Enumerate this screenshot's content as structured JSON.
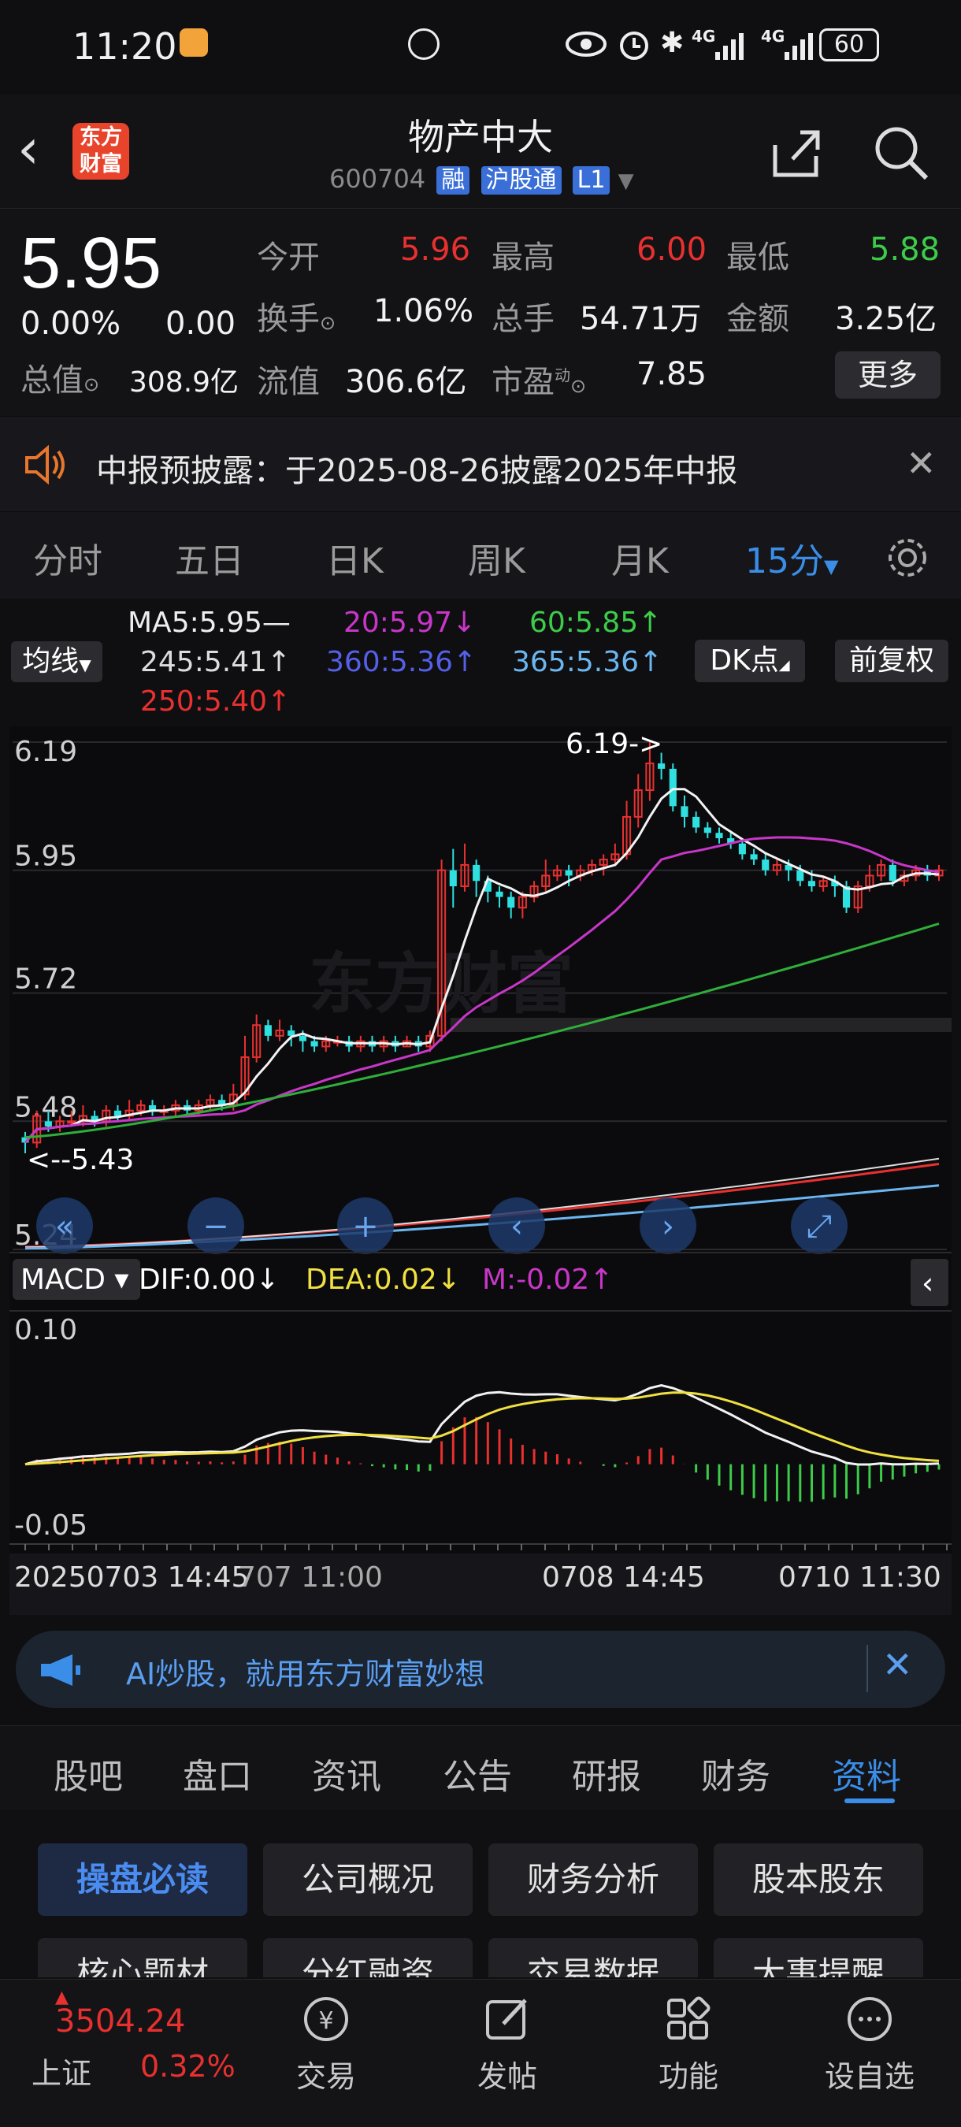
{
  "status": {
    "time": "11:20",
    "battery": "60",
    "net1": "4G",
    "net2": "4G"
  },
  "header": {
    "stock_name": "物产中大",
    "code": "600704",
    "badge1": "融",
    "badge2": "沪股通",
    "badge3": "L1",
    "logo": "东方财富"
  },
  "quote": {
    "price": "5.95",
    "change_pct": "0.00%",
    "change": "0.00",
    "open_label": "今开",
    "open": "5.96",
    "high_label": "最高",
    "high": "6.00",
    "low_label": "最低",
    "low": "5.88",
    "turnover_label": "换手",
    "turnover": "1.06%",
    "volume_label": "总手",
    "volume": "54.71万",
    "amount_label": "金额",
    "amount": "3.25亿",
    "mcap_label": "总值",
    "mcap": "308.9亿",
    "float_label": "流值",
    "float": "306.6亿",
    "pe_label": "市盈",
    "pe_sup": "动",
    "pe": "7.85",
    "more": "更多"
  },
  "notice": {
    "text": "中报预披露：于2025-08-26披露2025年中报"
  },
  "ktabs": [
    "分时",
    "五日",
    "日K",
    "周K",
    "月K",
    "15分"
  ],
  "ma": {
    "selector": "均线",
    "ma5": "MA5:5.95—",
    "ma20": "20:5.97↓",
    "ma60": "60:5.85↑",
    "ma245": "245:5.41↑",
    "ma360": "360:5.36↑",
    "ma365": "365:5.36↑",
    "ma250": "250:5.40↑",
    "dk": "DK点",
    "adjust": "前复权"
  },
  "colors": {
    "red": "#e8312f",
    "green": "#3dcc49",
    "cyan": "#33e0e0",
    "magenta": "#c837c8",
    "blue_accent": "#3a8ee8"
  },
  "chart_data": {
    "type": "candlestick",
    "y_ticks": [
      "6.19",
      "5.95",
      "5.72",
      "5.48",
      "5.24"
    ],
    "ylim": [
      5.24,
      6.19
    ],
    "annotations": [
      "6.19->",
      "<--5.43"
    ],
    "watermark": "东方财富",
    "x_labels": [
      "20250703 14:45",
      "707 11:00",
      "0708 14:45",
      "0710 11:30"
    ],
    "candles": [
      [
        5.45,
        5.44,
        5.46,
        5.42
      ],
      [
        5.44,
        5.49,
        5.5,
        5.43
      ],
      [
        5.48,
        5.47,
        5.5,
        5.46
      ],
      [
        5.47,
        5.48,
        5.49,
        5.46
      ],
      [
        5.48,
        5.48,
        5.5,
        5.47
      ],
      [
        5.48,
        5.49,
        5.51,
        5.47
      ],
      [
        5.49,
        5.48,
        5.5,
        5.47
      ],
      [
        5.48,
        5.5,
        5.51,
        5.47
      ],
      [
        5.5,
        5.49,
        5.51,
        5.48
      ],
      [
        5.49,
        5.5,
        5.52,
        5.48
      ],
      [
        5.5,
        5.51,
        5.52,
        5.49
      ],
      [
        5.51,
        5.5,
        5.52,
        5.49
      ],
      [
        5.5,
        5.5,
        5.51,
        5.49
      ],
      [
        5.5,
        5.51,
        5.52,
        5.49
      ],
      [
        5.51,
        5.5,
        5.52,
        5.49
      ],
      [
        5.5,
        5.51,
        5.52,
        5.49
      ],
      [
        5.51,
        5.52,
        5.53,
        5.5
      ],
      [
        5.52,
        5.51,
        5.53,
        5.5
      ],
      [
        5.51,
        5.53,
        5.55,
        5.5
      ],
      [
        5.53,
        5.6,
        5.64,
        5.52
      ],
      [
        5.6,
        5.66,
        5.68,
        5.59
      ],
      [
        5.66,
        5.64,
        5.67,
        5.63
      ],
      [
        5.64,
        5.65,
        5.67,
        5.63
      ],
      [
        5.65,
        5.64,
        5.66,
        5.62
      ],
      [
        5.64,
        5.63,
        5.65,
        5.61
      ],
      [
        5.63,
        5.62,
        5.64,
        5.61
      ],
      [
        5.62,
        5.63,
        5.64,
        5.61
      ],
      [
        5.63,
        5.63,
        5.64,
        5.62
      ],
      [
        5.63,
        5.62,
        5.64,
        5.61
      ],
      [
        5.62,
        5.63,
        5.64,
        5.61
      ],
      [
        5.63,
        5.62,
        5.64,
        5.61
      ],
      [
        5.62,
        5.63,
        5.64,
        5.61
      ],
      [
        5.63,
        5.62,
        5.64,
        5.61
      ],
      [
        5.62,
        5.63,
        5.64,
        5.62
      ],
      [
        5.63,
        5.62,
        5.64,
        5.61
      ],
      [
        5.62,
        5.64,
        5.65,
        5.61
      ],
      [
        5.64,
        5.95,
        5.97,
        5.63
      ],
      [
        5.95,
        5.92,
        5.99,
        5.88
      ],
      [
        5.92,
        5.96,
        6.0,
        5.91
      ],
      [
        5.96,
        5.93,
        5.97,
        5.9
      ],
      [
        5.93,
        5.91,
        5.94,
        5.89
      ],
      [
        5.91,
        5.9,
        5.92,
        5.88
      ],
      [
        5.9,
        5.88,
        5.91,
        5.86
      ],
      [
        5.88,
        5.9,
        5.91,
        5.86
      ],
      [
        5.9,
        5.92,
        5.93,
        5.89
      ],
      [
        5.92,
        5.94,
        5.97,
        5.91
      ],
      [
        5.94,
        5.95,
        5.96,
        5.93
      ],
      [
        5.95,
        5.94,
        5.96,
        5.92
      ],
      [
        5.94,
        5.95,
        5.96,
        5.93
      ],
      [
        5.95,
        5.96,
        5.97,
        5.94
      ],
      [
        5.96,
        5.97,
        5.98,
        5.94
      ],
      [
        5.97,
        5.98,
        6.0,
        5.96
      ],
      [
        5.98,
        6.05,
        6.08,
        5.97
      ],
      [
        6.05,
        6.1,
        6.13,
        6.03
      ],
      [
        6.1,
        6.15,
        6.19,
        6.08
      ],
      [
        6.15,
        6.14,
        6.17,
        6.12
      ],
      [
        6.14,
        6.07,
        6.15,
        6.06
      ],
      [
        6.07,
        6.05,
        6.09,
        6.03
      ],
      [
        6.05,
        6.03,
        6.06,
        6.02
      ],
      [
        6.03,
        6.02,
        6.04,
        6.01
      ],
      [
        6.02,
        6.01,
        6.03,
        6.0
      ],
      [
        6.01,
        6.0,
        6.02,
        5.99
      ],
      [
        6.0,
        5.98,
        6.01,
        5.97
      ],
      [
        5.98,
        5.97,
        5.99,
        5.96
      ],
      [
        5.97,
        5.95,
        5.98,
        5.94
      ],
      [
        5.95,
        5.96,
        5.97,
        5.94
      ],
      [
        5.96,
        5.95,
        5.97,
        5.93
      ],
      [
        5.95,
        5.93,
        5.96,
        5.92
      ],
      [
        5.93,
        5.92,
        5.95,
        5.91
      ],
      [
        5.92,
        5.93,
        5.94,
        5.91
      ],
      [
        5.93,
        5.92,
        5.94,
        5.9
      ],
      [
        5.92,
        5.88,
        5.93,
        5.87
      ],
      [
        5.88,
        5.92,
        5.93,
        5.87
      ],
      [
        5.92,
        5.94,
        5.96,
        5.91
      ],
      [
        5.94,
        5.96,
        5.97,
        5.93
      ],
      [
        5.96,
        5.93,
        5.97,
        5.92
      ],
      [
        5.93,
        5.94,
        5.95,
        5.92
      ],
      [
        5.94,
        5.95,
        5.96,
        5.93
      ],
      [
        5.95,
        5.94,
        5.96,
        5.93
      ],
      [
        5.94,
        5.95,
        5.96,
        5.93
      ]
    ],
    "macd": {
      "selector": "MACD",
      "dif": "DIF:0.00↓",
      "dea": "DEA:0.02↓",
      "m": "M:-0.02↑",
      "ylim_labels": [
        "0.10",
        "-0.05"
      ]
    }
  },
  "ai_banner": {
    "text": "AI炒股，就用东方财富妙想"
  },
  "bottom_tabs": [
    "股吧",
    "盘口",
    "资讯",
    "公告",
    "研报",
    "财务",
    "资料"
  ],
  "grid_buttons": [
    "操盘必读",
    "公司概况",
    "财务分析",
    "股本股东",
    "核心题材",
    "分红融资",
    "交易数据",
    "大事提醒"
  ],
  "nav": {
    "index_value": "3504.24",
    "index_name": "上证",
    "index_pct": "0.32%",
    "trade": "交易",
    "post": "发帖",
    "func": "功能",
    "watch": "设自选"
  }
}
